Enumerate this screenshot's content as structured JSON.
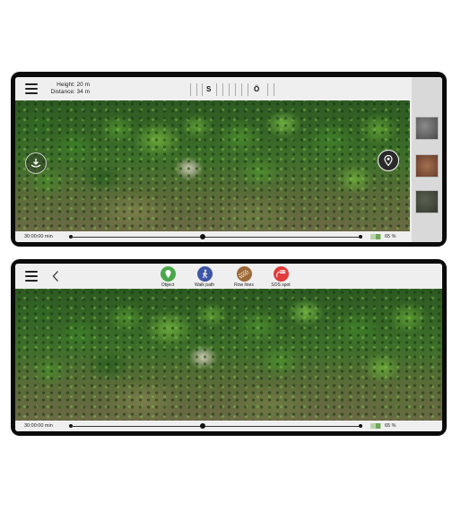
{
  "top_view": {
    "info": {
      "height": "Height: 20 m",
      "distance": "Distance: 34 m"
    },
    "compass": {
      "south": "S",
      "west": "Ö"
    },
    "timeline": {
      "time": "30:00:00 min",
      "battery": "65 %"
    },
    "side_panel": {
      "thumbnails": [
        "photo-thumbnail-gray",
        "photo-thumbnail-red",
        "photo-thumbnail-dark"
      ]
    }
  },
  "bottom_view": {
    "actions": [
      {
        "label": "Object",
        "color": "#49a84a",
        "icon": "pin-icon"
      },
      {
        "label": "Walk path",
        "color": "#3d55a8",
        "icon": "walker-icon"
      },
      {
        "label": "Row lines",
        "color": "#9c6a3a",
        "icon": "rows-icon"
      },
      {
        "label": "SOS spot",
        "color": "#e23b3b",
        "icon": "sos-icon"
      }
    ],
    "timeline": {
      "time": "30:00:00 min",
      "battery": "65 %"
    }
  },
  "colors": {
    "device": "#0b0b0b",
    "bar": "#efefef",
    "battery": "#6fa85a"
  }
}
